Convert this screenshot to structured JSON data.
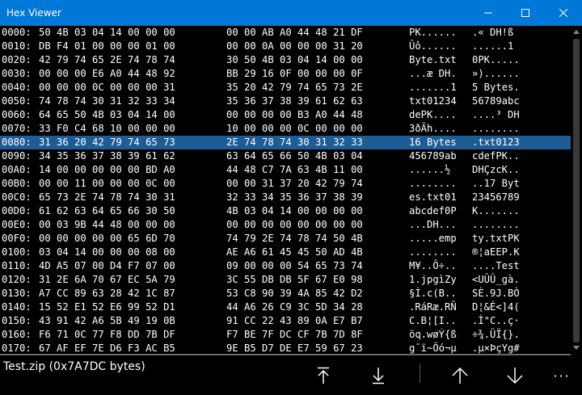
{
  "window": {
    "title": "Hex Viewer",
    "colors": {
      "titlebar": "#0078d7",
      "selection": "#1e5c96",
      "background": "#000000"
    }
  },
  "hex_rows": [
    {
      "offset": "0000:",
      "hex1": "50 4B 03 04 14 00 00 00",
      "hex2": "00 00 AB A0 44 48 21 DF",
      "ascii1": "PK......",
      "ascii2": ".« DH!ß"
    },
    {
      "offset": "0010:",
      "hex1": "DB F4 01 00 00 00 01 00",
      "hex2": "00 00 0A 00 00 00 31 20",
      "ascii1": "Ûô......",
      "ascii2": "......1"
    },
    {
      "offset": "0020:",
      "hex1": "42 79 74 65 2E 74 78 74",
      "hex2": "30 50 4B 03 04 14 00 00",
      "ascii1": "Byte.txt",
      "ascii2": "0PK....."
    },
    {
      "offset": "0030:",
      "hex1": "00 00 00 E6 A0 44 48 92",
      "hex2": "BB 29 16 0F 00 00 00 0F",
      "ascii1": "...æ DH.",
      "ascii2": "»)......"
    },
    {
      "offset": "0040:",
      "hex1": "00 00 00 0C 00 00 00 31",
      "hex2": "35 20 42 79 74 65 73 2E",
      "ascii1": ".......1",
      "ascii2": "5 Bytes."
    },
    {
      "offset": "0050:",
      "hex1": "74 78 74 30 31 32 33 34",
      "hex2": "35 36 37 38 39 61 62 63",
      "ascii1": "txt01234",
      "ascii2": "56789abc"
    },
    {
      "offset": "0060:",
      "hex1": "64 65 50 4B 03 04 14 00",
      "hex2": "00 00 00 00 B3 A0 44 48",
      "ascii1": "dePK....",
      "ascii2": "....³ DH"
    },
    {
      "offset": "0070:",
      "hex1": "33 F0 C4 68 10 00 00 00",
      "hex2": "10 00 00 00 0C 00 00 00",
      "ascii1": "3ðÄh....",
      "ascii2": "........"
    },
    {
      "offset": "0080:",
      "hex1": "31 36 20 42 79 74 65 73",
      "hex2": "2E 74 78 74 30 31 32 33",
      "ascii1": "16 Bytes",
      "ascii2": ".txt0123",
      "selected": true
    },
    {
      "offset": "0090:",
      "hex1": "34 35 36 37 38 39 61 62",
      "hex2": "63 64 65 66 50 4B 03 04",
      "ascii1": "456789ab",
      "ascii2": "cdefPK.."
    },
    {
      "offset": "00A0:",
      "hex1": "14 00 00 00 00 00 BD A0",
      "hex2": "44 48 C7 7A 63 4B 11 00",
      "ascii1": "......½",
      "ascii2": "DHÇzcK.."
    },
    {
      "offset": "00B0:",
      "hex1": "00 00 11 00 00 00 0C 00",
      "hex2": "00 00 31 37 20 42 79 74",
      "ascii1": "........",
      "ascii2": "..17 Byt"
    },
    {
      "offset": "00C0:",
      "hex1": "65 73 2E 74 78 74 30 31",
      "hex2": "32 33 34 35 36 37 38 39",
      "ascii1": "es.txt01",
      "ascii2": "23456789"
    },
    {
      "offset": "00D0:",
      "hex1": "61 62 63 64 65 66 30 50",
      "hex2": "4B 03 04 14 00 00 00 00",
      "ascii1": "abcdef0P",
      "ascii2": "K......."
    },
    {
      "offset": "00E0:",
      "hex1": "00 03 9B 44 48 00 00 00",
      "hex2": "00 00 00 00 00 00 00 00",
      "ascii1": "...DH...",
      "ascii2": "........"
    },
    {
      "offset": "00F0:",
      "hex1": "00 00 00 00 00 65 6D 70",
      "hex2": "74 79 2E 74 78 74 50 4B",
      "ascii1": ".....emp",
      "ascii2": "ty.txtPK"
    },
    {
      "offset": "0100:",
      "hex1": "03 04 14 00 00 00 08 00",
      "hex2": "AE A6 61 45 45 50 AD 4B",
      "ascii1": "........",
      "ascii2": "®¦aEEP.K"
    },
    {
      "offset": "0110:",
      "hex1": "4D A5 07 00 D4 F7 07 00",
      "hex2": "09 00 00 00 54 65 73 74",
      "ascii1": "M¥..Ô÷..",
      "ascii2": "....Test"
    },
    {
      "offset": "0120:",
      "hex1": "31 2E 6A 70 67 EC 5A 79",
      "hex2": "3C 55 DB DB 5F 67 E0 98",
      "ascii1": "1.jpgìZy",
      "ascii2": "<UÛÛ_gà."
    },
    {
      "offset": "0130:",
      "hex1": "A7 CC 89 63 28 42 1C 87",
      "hex2": "53 C8 90 39 4A 85 42 D2",
      "ascii1": "§Ì.c(B..",
      "ascii2": "SÈ.9J.BÒ"
    },
    {
      "offset": "0140:",
      "hex1": "15 52 E1 52 E6 99 52 D1",
      "hex2": "44 A6 26 C9 3C 5D 34 28",
      "ascii1": ".RáRæ.RÑ",
      "ascii2": "D¦&É<]4("
    },
    {
      "offset": "0150:",
      "hex1": "43 91 42 A6 5B 49 19 0B",
      "hex2": "91 CC 22 43 89 0A E7 B7",
      "ascii1": "C.B¦[I..",
      "ascii2": ".Ì\"C..ç·"
    },
    {
      "offset": "0160:",
      "hex1": "F6 71 0C 77 F8 DD 7B DF",
      "hex2": "F7 BE 7F DC CF 7B 7D 8F",
      "ascii1": "öq.wøÝ{ß",
      "ascii2": "÷¾.ÜÏ{}."
    },
    {
      "offset": "0170:",
      "hex1": "67 AF EF 7E D6 F3 AC B5",
      "hex2": "9E B5 D7 DE E7 59 67 23",
      "ascii1": "g¯ï~Öó¬µ",
      "ascii2": ".µ×ÞçYg#"
    }
  ],
  "status": {
    "text": "Test.zip (0x7A7DC bytes)"
  },
  "toolbar": {
    "btn1_icon": "arrow-up-to-top-icon",
    "btn2_icon": "arrow-down-to-bottom-icon",
    "btn3_icon": "arrow-up-icon",
    "btn4_icon": "arrow-down-icon",
    "more": "···"
  }
}
